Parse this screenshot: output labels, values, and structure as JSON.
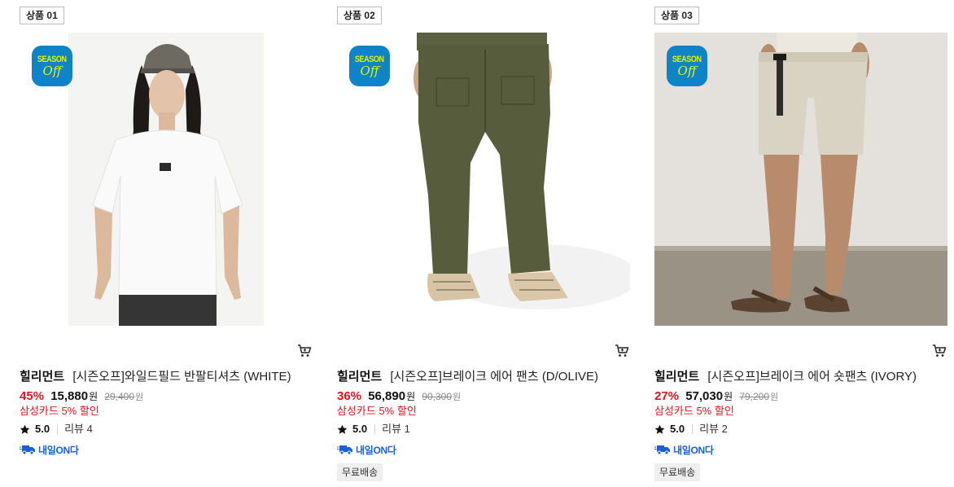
{
  "products": [
    {
      "rank_label": "상품 01",
      "season_badge": {
        "line1": "SEASON",
        "line2": "Off"
      },
      "brand": "힐리먼트",
      "name": "[시즌오프]와일드필드 반팔티셔츠 (WHITE)",
      "discount_rate": "45%",
      "price": "15,880",
      "price_unit": "원",
      "original_price": "29,400",
      "original_unit": "원",
      "card_promo": "삼성카드 5% 할인",
      "rating": "5.0",
      "review_label": "리뷰 4",
      "delivery_badge": {
        "prefix": "내일",
        "suffix": "ON다"
      },
      "free_shipping": ""
    },
    {
      "rank_label": "상품 02",
      "season_badge": {
        "line1": "SEASON",
        "line2": "Off"
      },
      "brand": "힐리먼트",
      "name": "[시즌오프]브레이크 에어 팬츠 (D/OLIVE)",
      "discount_rate": "36%",
      "price": "56,890",
      "price_unit": "원",
      "original_price": "90,300",
      "original_unit": "원",
      "card_promo": "삼성카드 5% 할인",
      "rating": "5.0",
      "review_label": "리뷰 1",
      "delivery_badge": {
        "prefix": "내일",
        "suffix": "ON다"
      },
      "free_shipping": "무료배송"
    },
    {
      "rank_label": "상품 03",
      "season_badge": {
        "line1": "SEASON",
        "line2": "Off"
      },
      "brand": "힐리먼트",
      "name": "[시즌오프]브레이크 에어 숏팬츠 (IVORY)",
      "discount_rate": "27%",
      "price": "57,030",
      "price_unit": "원",
      "original_price": "79,200",
      "original_unit": "원",
      "card_promo": "삼성카드 5% 할인",
      "rating": "5.0",
      "review_label": "리뷰 2",
      "delivery_badge": {
        "prefix": "내일",
        "suffix": "ON다"
      },
      "free_shipping": "무료배송"
    }
  ],
  "icons": {
    "cart": "cart-icon",
    "star": "star-icon",
    "delivery": "delivery-truck-icon"
  },
  "colors": {
    "discount": "#e1131c",
    "season_badge_bg": "#0e84c7",
    "season_badge_text": "#d8f21a",
    "delivery_blue": "#1b5fd6"
  }
}
